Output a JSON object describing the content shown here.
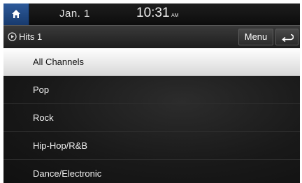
{
  "status_bar": {
    "date": "Jan. 1",
    "time": "10:31",
    "ampm": "AM",
    "home_icon": "home-icon"
  },
  "header": {
    "station": "Hits 1",
    "menu_label": "Menu",
    "play_icon": "play-circle-icon",
    "back_icon": "back-arrow-icon"
  },
  "channels": {
    "selected_index": 0,
    "items": [
      {
        "label": "All Channels"
      },
      {
        "label": "Pop"
      },
      {
        "label": "Rock"
      },
      {
        "label": "Hip-Hop/R&B"
      },
      {
        "label": "Dance/Electronic"
      }
    ]
  },
  "colors": {
    "accent_home": "#2d5a9a",
    "selected_row": "#ffffff",
    "background": "#141414"
  }
}
